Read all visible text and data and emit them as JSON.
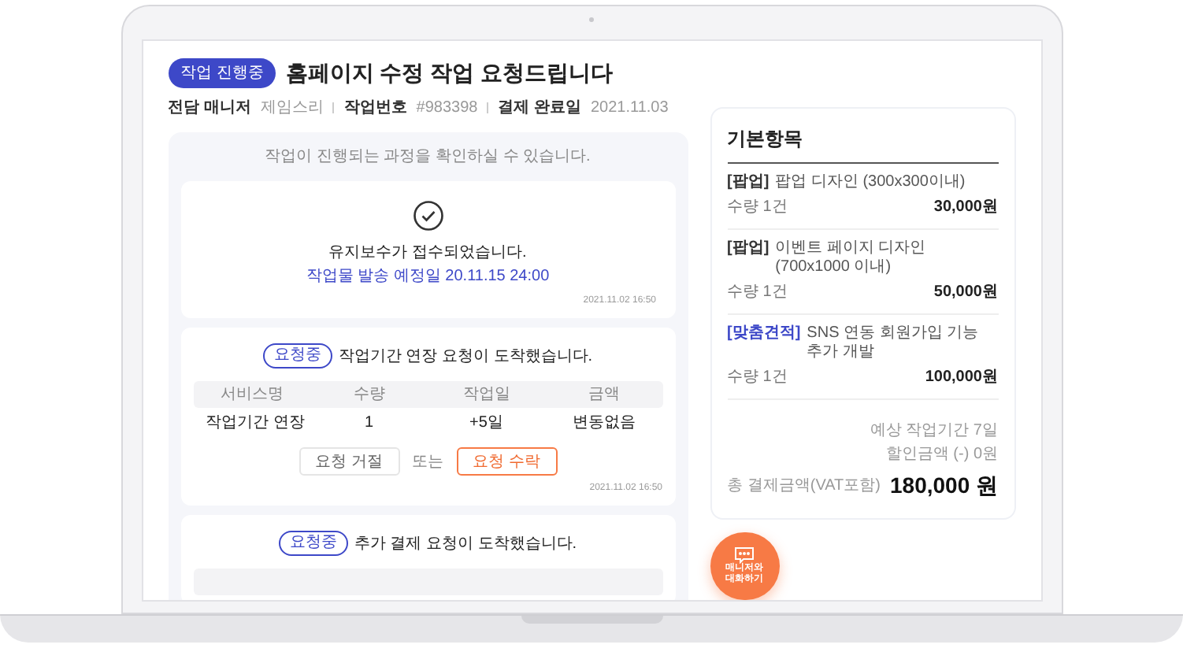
{
  "status_badge": "작업 진행중",
  "title": "홈페이지 수정 작업 요청드립니다",
  "meta": [
    {
      "label": "전담 매니저",
      "value": "제임스리"
    },
    {
      "label": "작업번호",
      "value": "#983398"
    },
    {
      "label": "결제 완료일",
      "value": "2021.11.03"
    }
  ],
  "progress": {
    "intro": "작업이 진행되는 과정을 확인하실 수 있습니다.",
    "cards": [
      {
        "kind": "notice",
        "message": "유지보수가 접수되었습니다.",
        "sub": "작업물 발송 예정일 20.11.15 24:00",
        "timestamp": "2021.11.02 16:50"
      },
      {
        "kind": "request",
        "badge": "요청중",
        "message": "작업기간 연장 요청이 도착했습니다.",
        "columns": [
          "서비스명",
          "수량",
          "작업일",
          "금액"
        ],
        "rows": [
          [
            "작업기간 연장",
            "1",
            "+5일",
            "변동없음"
          ]
        ],
        "reject": "요청 거절",
        "or": "또는",
        "accept": "요청 수락",
        "timestamp": "2021.11.02 16:50"
      },
      {
        "kind": "request",
        "badge": "요청중",
        "message": "추가 결제 요청이 도착했습니다."
      }
    ]
  },
  "summary": {
    "title": "기본항목",
    "items": [
      {
        "tag": "[팝업]",
        "name": "팝업 디자인 (300x300이내)",
        "quantity": "수량 1건",
        "price": "30,000원",
        "color": "#333333"
      },
      {
        "tag": "[팝업]",
        "name": "이벤트 페이지 디자인(700x1000 이내)",
        "quantity": "수량 1건",
        "price": "50,000원",
        "color": "#333333"
      },
      {
        "tag": "[맞춤견적]",
        "name": "SNS 연동 회원가입 기능 추가 개발",
        "quantity": "수량 1건",
        "price": "100,000원",
        "color": "#3d48c8"
      }
    ],
    "period": "예상 작업기간 7일",
    "discount": "할인금액 (-) 0원",
    "total_label": "총 결제금액(VAT포함)",
    "total": "180,000 원"
  },
  "chat_button": [
    "매니저와",
    "대화하기"
  ]
}
